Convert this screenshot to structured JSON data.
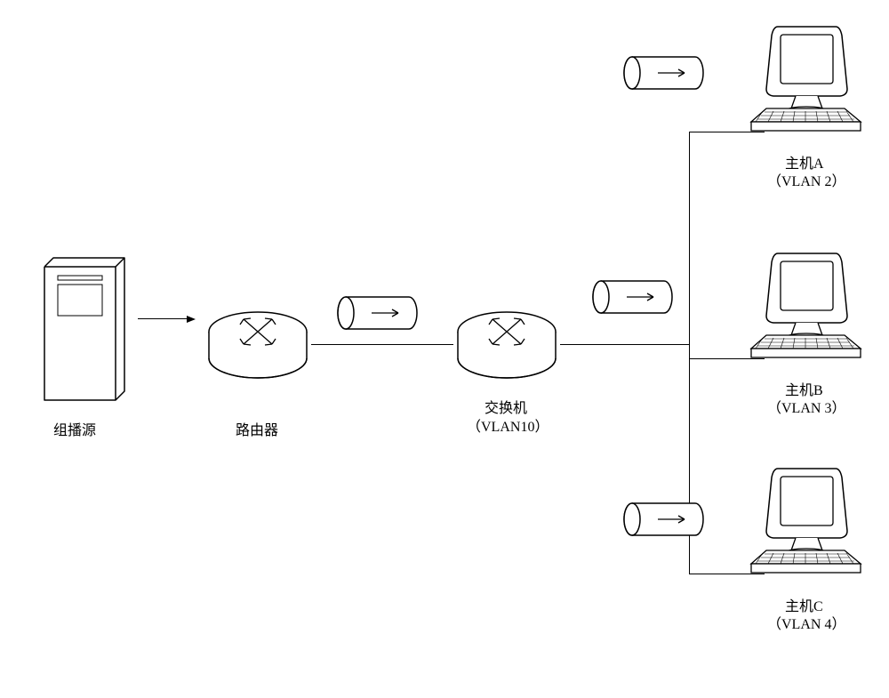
{
  "source": {
    "label": "组播源"
  },
  "router": {
    "label": "路由器"
  },
  "switch": {
    "label_line1": "交换机",
    "label_line2": "（VLAN10）"
  },
  "hosts": {
    "a": {
      "name": "主机A",
      "vlan": "（VLAN 2）"
    },
    "b": {
      "name": "主机B",
      "vlan": "（VLAN 3）"
    },
    "c": {
      "name": "主机C",
      "vlan": "（VLAN 4）"
    }
  },
  "icons": {
    "server": "server-icon",
    "router": "router-icon",
    "switch": "switch-icon",
    "computer": "computer-icon",
    "packet": "packet-icon"
  }
}
